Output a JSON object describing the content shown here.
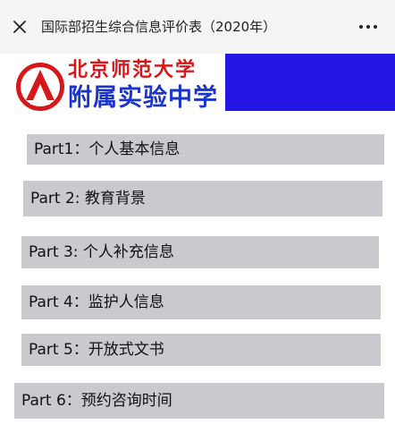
{
  "header": {
    "title": "国际部招生综合信息评价表（2020年）",
    "close_icon": "close-icon",
    "more_icon": "more-icon"
  },
  "banner": {
    "school_line1": "北京师范大学",
    "school_line2": "附属实验中学",
    "logo_icon": "school-logo",
    "colors": {
      "red": "#d61818",
      "blue_text": "#1b35c9",
      "blue_block": "#2516e6"
    }
  },
  "parts": [
    {
      "label": "Part1：个人基本信息"
    },
    {
      "label": "Part 2: 教育背景"
    },
    {
      "label": "Part 3: 个人补充信息"
    },
    {
      "label": "Part 4：监护人信息"
    },
    {
      "label": "Part 5：开放式文书"
    },
    {
      "label": "Part 6：预约咨询时间"
    }
  ]
}
